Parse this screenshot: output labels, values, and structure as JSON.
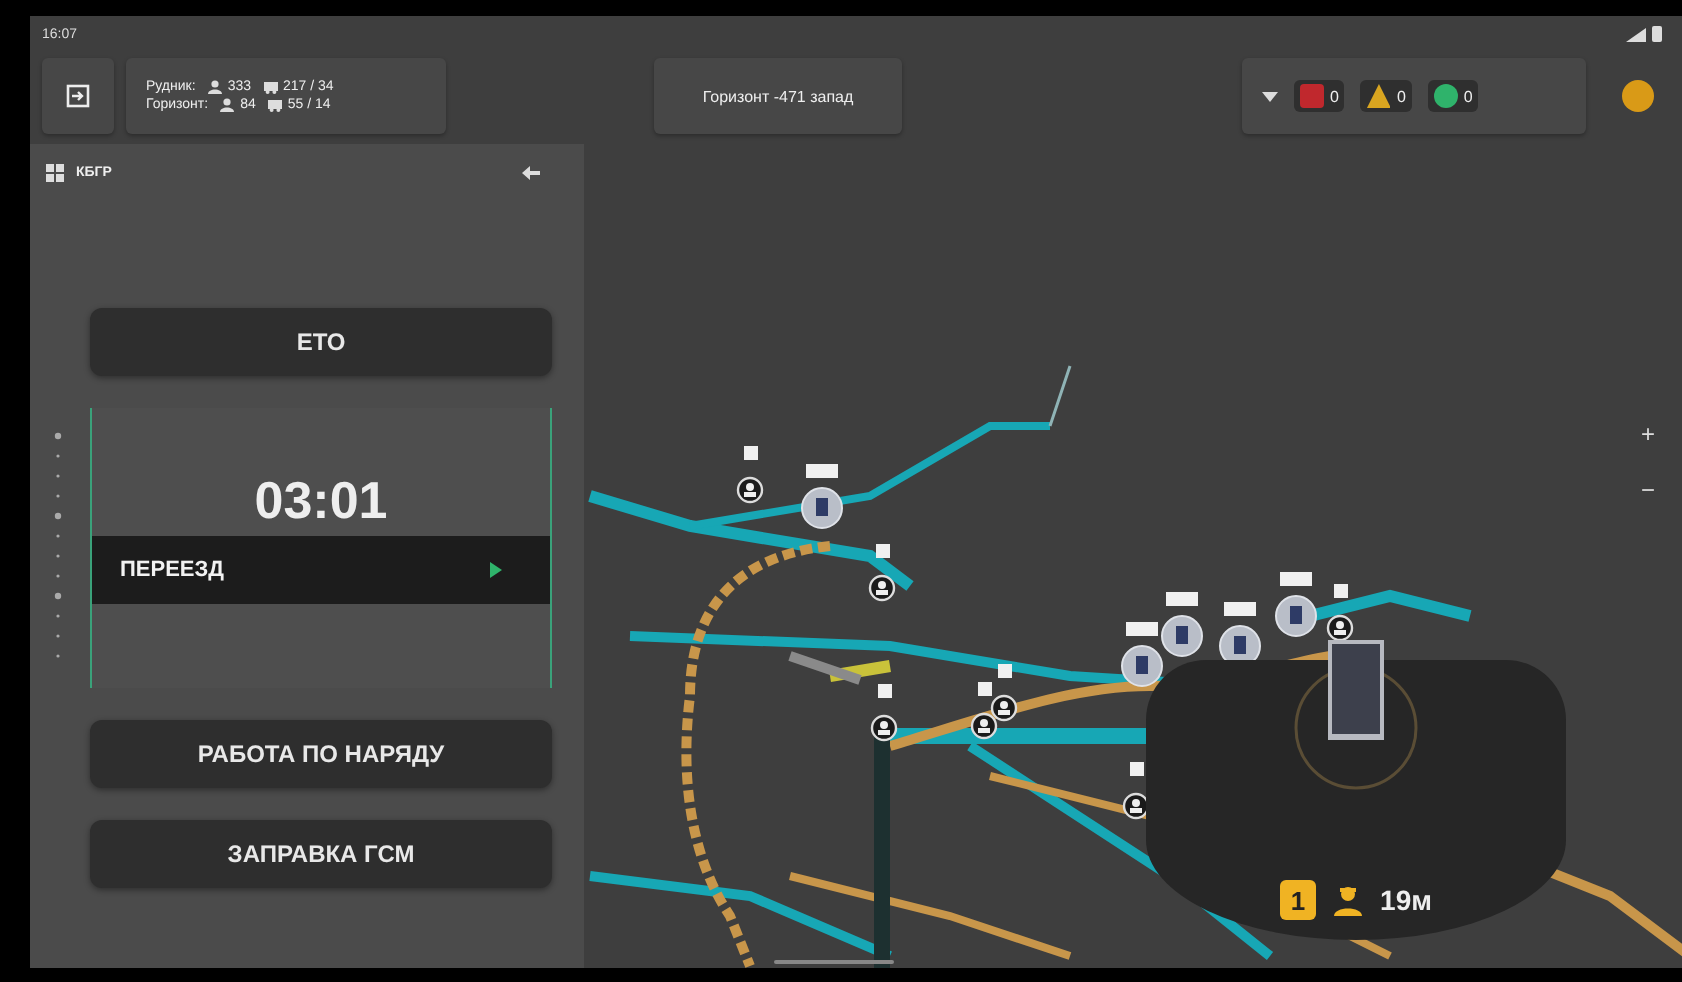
{
  "status_bar": {
    "time": "16:07"
  },
  "top_bar": {
    "stats": [
      {
        "label": "Рудник:",
        "people": "333",
        "vehicles": "217 / 34"
      },
      {
        "label": "Горизонт:",
        "people": "84",
        "vehicles": "55 / 14"
      }
    ],
    "horizon": "Горизонт -471 запад",
    "alerts": [
      {
        "kind": "error",
        "count": "0",
        "color": "#c0282d"
      },
      {
        "kind": "warning",
        "count": "0",
        "color": "#d9a520"
      },
      {
        "kind": "ok",
        "count": "0",
        "color": "#2fb36b"
      }
    ]
  },
  "panel": {
    "title": "КБГР",
    "actions": [
      {
        "kind": "button",
        "label": "ЕТО"
      },
      {
        "kind": "status",
        "time": "03:01",
        "mode": "ПЕРЕЕЗД"
      },
      {
        "kind": "button",
        "label": "РАБОТА ПО НАРЯДУ"
      },
      {
        "kind": "button",
        "label": "ЗАПРАВКА ГСМ"
      }
    ]
  },
  "map_controls": [
    "+",
    "−"
  ],
  "vehicle_card": {
    "count": "1",
    "distance": "19м"
  }
}
